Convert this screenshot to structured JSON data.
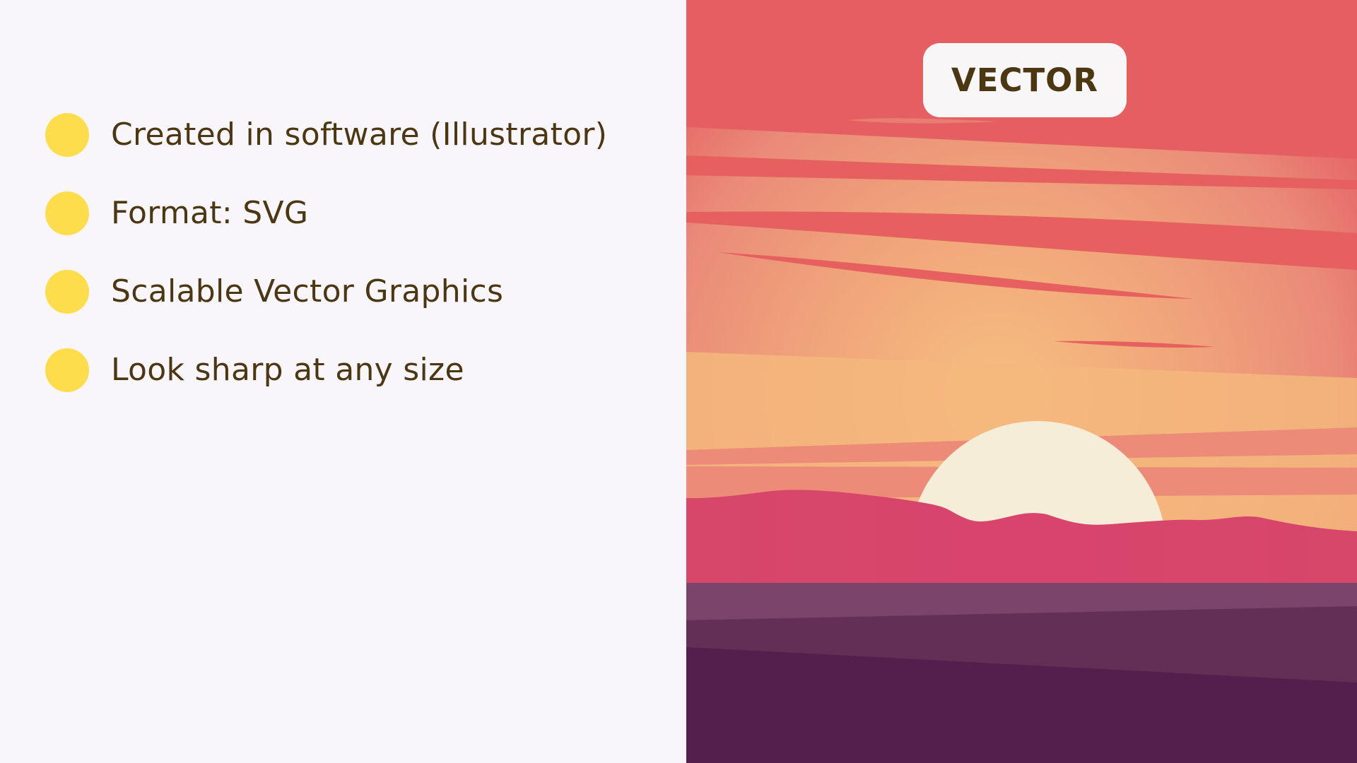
{
  "colors": {
    "background": "#f8f6fa",
    "bullet": "#fedd4c",
    "text": "#4b3712",
    "sky_top": "#e55f62",
    "sky_mid": "#ec8e7a",
    "sky_low": "#f4b87e",
    "sun": "#f6edd8",
    "hills": "#d6476a",
    "water_light": "#7a446b",
    "water_mid": "#642f57",
    "water_dark": "#531f4b"
  },
  "bullets": [
    {
      "text": "Created in software (Illustrator)"
    },
    {
      "text": "Format: SVG"
    },
    {
      "text": "Scalable Vector Graphics"
    },
    {
      "text": "Look sharp at any size"
    }
  ],
  "illustration": {
    "badge_label": "VECTOR",
    "scene": "sunset-over-hills"
  }
}
